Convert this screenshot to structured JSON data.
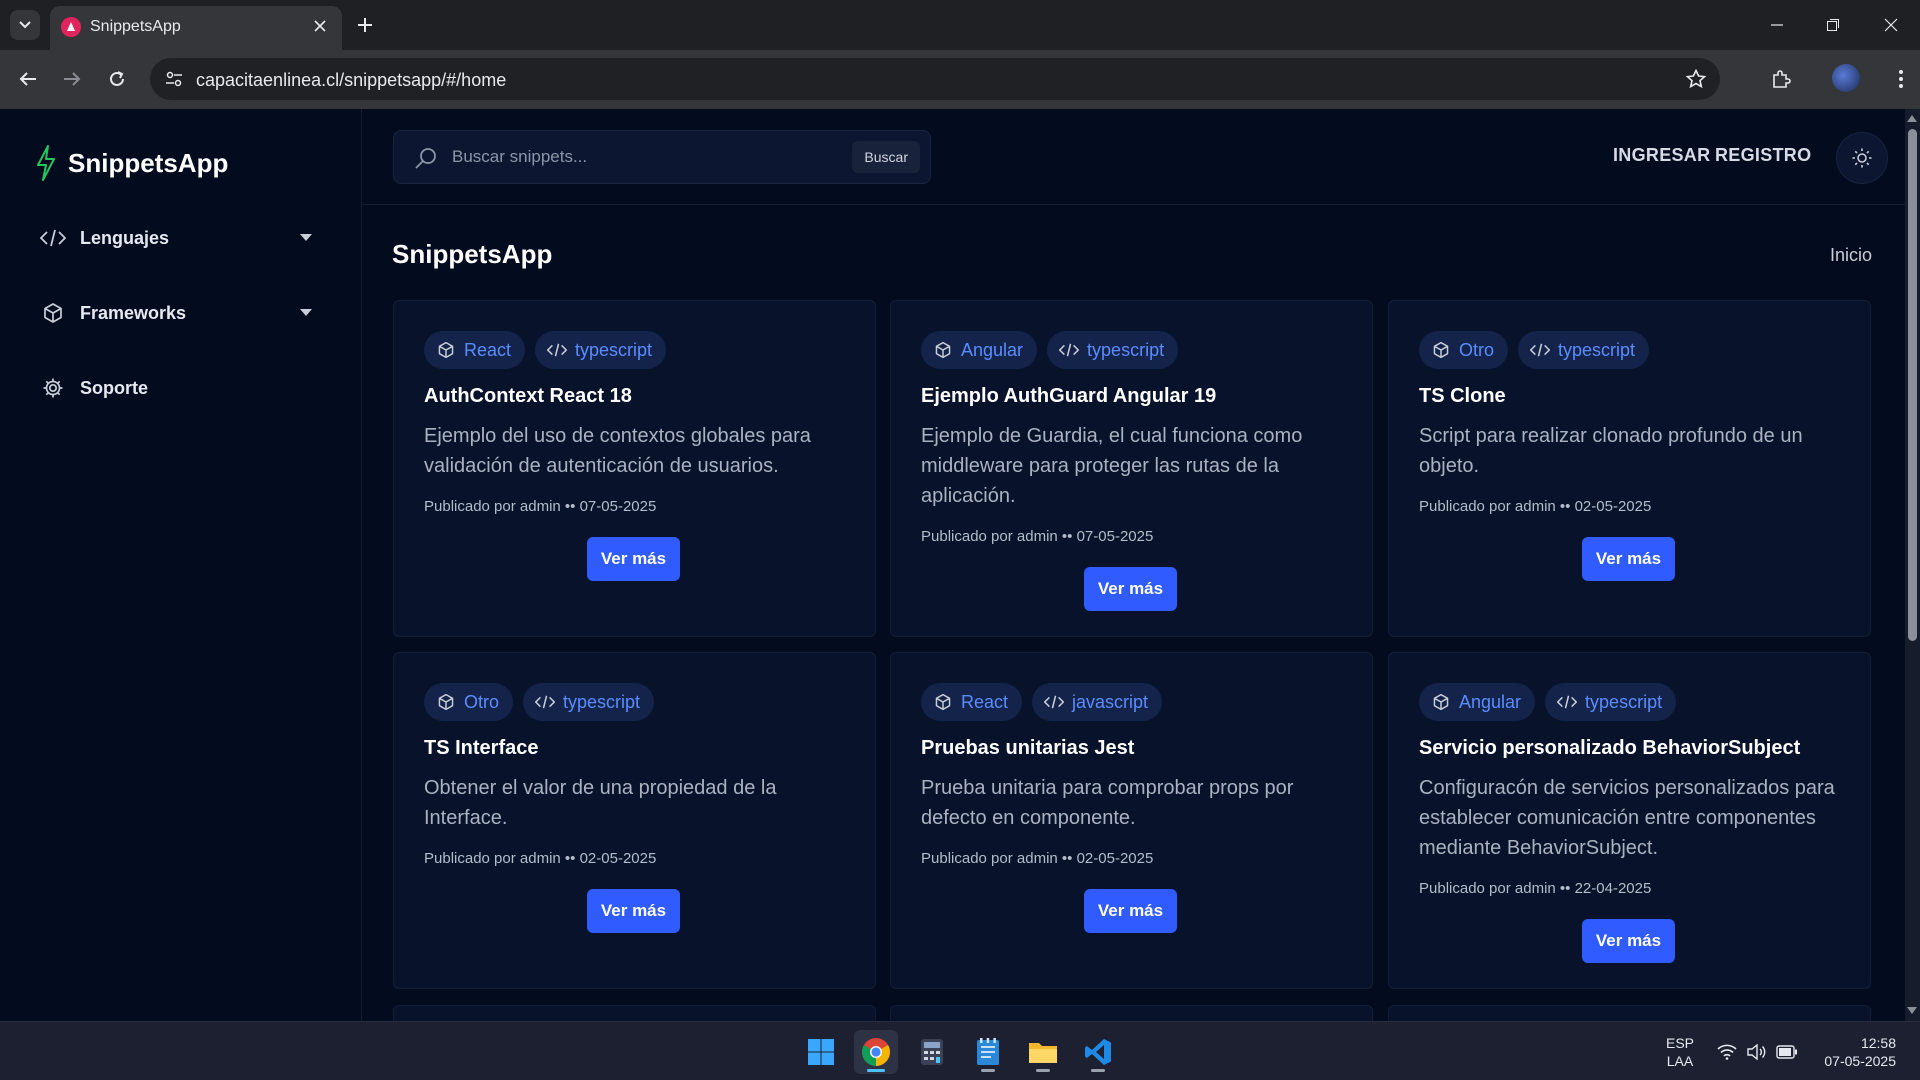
{
  "browser": {
    "tab_title": "SnippetsApp",
    "url": "capacitaenlinea.cl/snippetsapp/#/home"
  },
  "sidebar": {
    "brand": "SnippetsApp",
    "items": [
      {
        "label": "Lenguajes",
        "icon": "code-icon"
      },
      {
        "label": "Frameworks",
        "icon": "box-icon"
      },
      {
        "label": "Soporte",
        "icon": "gear-icon"
      }
    ]
  },
  "header": {
    "search_placeholder": "Buscar snippets...",
    "search_button": "Buscar",
    "login": "INGRESAR",
    "register": "REGISTRO"
  },
  "main": {
    "title": "SnippetsApp",
    "breadcrumb": "Inicio"
  },
  "cards": [
    {
      "framework": "React",
      "language": "typescript",
      "title": "AuthContext React 18",
      "description": "Ejemplo del uso de contextos globales para validación de autenticación de usuarios.",
      "meta": "Publicado por admin •• 07-05-2025",
      "button": "Ver más"
    },
    {
      "framework": "Angular",
      "language": "typescript",
      "title": "Ejemplo AuthGuard Angular 19",
      "description": "Ejemplo de Guardia, el cual funciona como middleware para proteger las rutas de la aplicación.",
      "meta": "Publicado por admin •• 07-05-2025",
      "button": "Ver más"
    },
    {
      "framework": "Otro",
      "language": "typescript",
      "title": "TS Clone",
      "description": "Script para realizar clonado profundo de un objeto.",
      "meta": "Publicado por admin •• 02-05-2025",
      "button": "Ver más"
    },
    {
      "framework": "Otro",
      "language": "typescript",
      "title": "TS Interface",
      "description": "Obtener el valor de una propiedad de la Interface.",
      "meta": "Publicado por admin •• 02-05-2025",
      "button": "Ver más"
    },
    {
      "framework": "React",
      "language": "javascript",
      "title": "Pruebas unitarias Jest",
      "description": "Prueba unitaria para comprobar props por defecto en componente.",
      "meta": "Publicado por admin •• 02-05-2025",
      "button": "Ver más"
    },
    {
      "framework": "Angular",
      "language": "typescript",
      "title": "Servicio personalizado BehaviorSubject",
      "description": "Configuracón de servicios personalizados para establecer comunicación entre componentes mediante BehaviorSubject.",
      "meta": "Publicado por admin •• 22-04-2025",
      "button": "Ver más"
    }
  ],
  "taskbar": {
    "lang_1": "ESP",
    "lang_2": "LAA",
    "time": "12:58",
    "date": "07-05-2025"
  },
  "colors": {
    "accent": "#2f5bff",
    "badge_text": "#5b8cff",
    "brand_bolt": "#22c55e",
    "background": "#030b1f"
  }
}
